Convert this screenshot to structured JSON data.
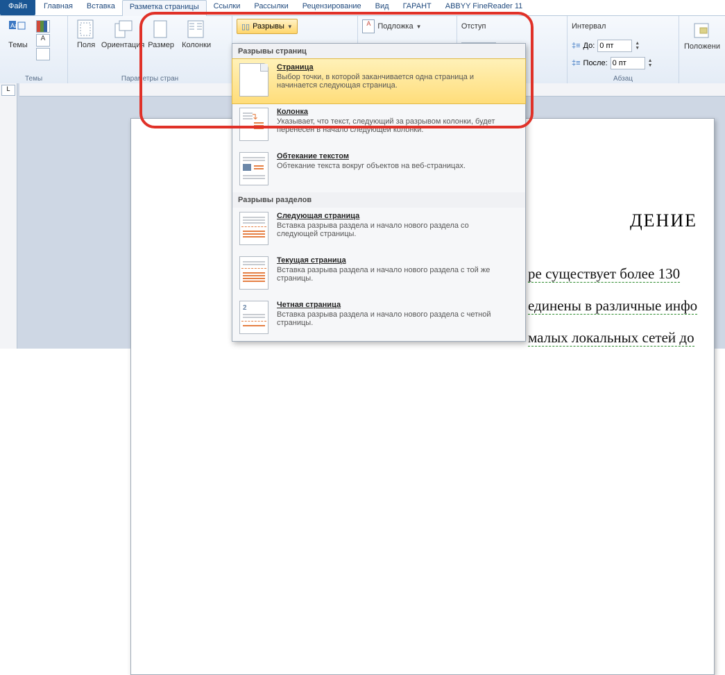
{
  "tabs": {
    "file": "Файл",
    "home": "Главная",
    "insert": "Вставка",
    "layout": "Разметка страницы",
    "links": "Ссылки",
    "mailings": "Рассылки",
    "review": "Рецензирование",
    "view": "Вид",
    "garant": "ГАРАНТ",
    "abbyy": "ABBYY FineReader 11"
  },
  "ribbon": {
    "themes_group": "Темы",
    "themes_btn": "Темы",
    "page_setup_group": "Параметры стран",
    "margins": "Поля",
    "orientation": "Ориентация",
    "size": "Размер",
    "columns": "Колонки",
    "breaks": "Разрывы",
    "watermark": "Подложка",
    "indent": "Отступ",
    "spacing": "Интервал",
    "before": "До:",
    "after": "После:",
    "val_before": "0 пт",
    "val_after": "0 пт",
    "paragraph_group": "Абзац",
    "position": "Положени"
  },
  "dropdown": {
    "section1": "Разрывы страниц",
    "section2": "Разрывы разделов",
    "items": [
      {
        "title": "Страница",
        "desc": "Выбор точки, в которой заканчивается одна страница и начинается следующая страница."
      },
      {
        "title": "Колонка",
        "desc": "Указывает, что текст, следующий за разрывом колонки, будет перенесен в начало следующей колонки."
      },
      {
        "title": "Обтекание текстом",
        "desc": "Обтекание текста вокруг объектов на веб-страницах."
      },
      {
        "title": "Следующая страница",
        "desc": "Вставка разрыва раздела и начало нового раздела со следующей страницы."
      },
      {
        "title": "Текущая страница",
        "desc": "Вставка разрыва раздела и начало нового раздела с той же страницы."
      },
      {
        "title": "Четная страница",
        "desc": "Вставка разрыва раздела и начало нового раздела с четной страницы."
      }
    ]
  },
  "doc": {
    "heading_fragment": "ДЕНИЕ",
    "line1": "ре существует более 130",
    "line2": "единены в различные инфо",
    "line3": "малых локальных сетей до"
  },
  "ruler_corner": "L"
}
